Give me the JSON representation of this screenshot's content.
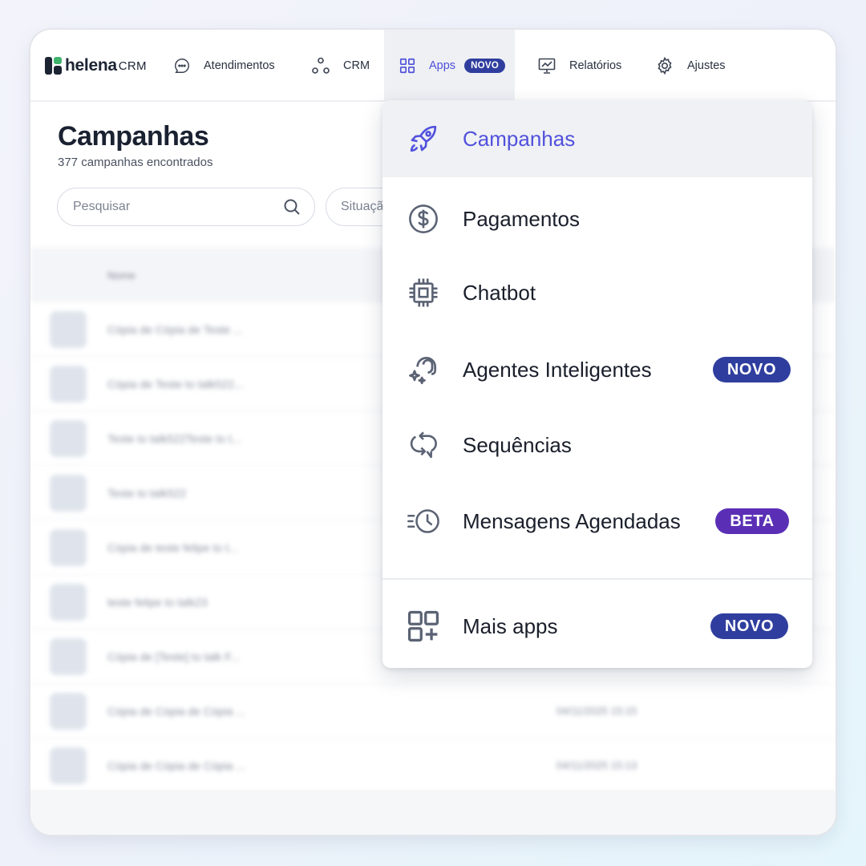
{
  "colors": {
    "accent": "#5151dd",
    "badge_novo": "#2f3e9e",
    "badge_beta": "#5b2fb5",
    "text": "#1a1f2b"
  },
  "brand": {
    "name": "helena",
    "suffix": "CRM"
  },
  "nav": {
    "items": [
      {
        "label": "Atendimentos",
        "icon": "chat-bubble-icon"
      },
      {
        "label": "CRM",
        "icon": "nodes-icon"
      },
      {
        "label": "Apps",
        "icon": "grid-icon",
        "badge": "NOVO",
        "active": true
      },
      {
        "label": "Relatórios",
        "icon": "chart-board-icon"
      },
      {
        "label": "Ajustes",
        "icon": "gear-icon"
      }
    ]
  },
  "page": {
    "title": "Campanhas",
    "subtitle": "377 campanhas encontrados",
    "search_placeholder": "Pesquisar",
    "filter_label": "Situação"
  },
  "table": {
    "header": "Nome",
    "rows": [
      {
        "name": "Cópia de Cópia de Teste ...",
        "date": ""
      },
      {
        "name": "Cópia de Teste to talk522...",
        "date": ""
      },
      {
        "name": "Teste to talk522Teste to t...",
        "date": ""
      },
      {
        "name": "Teste to talk522",
        "date": ""
      },
      {
        "name": "Cópia de teste felipe to t...",
        "date": ""
      },
      {
        "name": "teste felipe to talk23",
        "date": ""
      },
      {
        "name": "Cópia de [Teste] to talk F...",
        "date": ""
      },
      {
        "name": "Cópia de Cópia de Cópia ...",
        "date": "04/11/2025 15:15"
      },
      {
        "name": "Cópia de Cópia de Cópia ...",
        "date": "04/11/2025 15:13"
      }
    ]
  },
  "menu": {
    "items": [
      {
        "label": "Campanhas",
        "icon": "rocket-icon"
      },
      {
        "label": "Pagamentos",
        "icon": "dollar-circle-icon"
      },
      {
        "label": "Chatbot",
        "icon": "chip-icon"
      },
      {
        "label": "Agentes Inteligentes",
        "icon": "agent-sparkle-icon",
        "badge": "NOVO"
      },
      {
        "label": "Sequências",
        "icon": "loop-arrows-icon"
      },
      {
        "label": "Mensagens Agendadas",
        "icon": "scheduled-clock-icon",
        "badge": "BETA"
      }
    ],
    "more": {
      "label": "Mais apps",
      "icon": "grid-plus-icon",
      "badge": "NOVO"
    }
  }
}
